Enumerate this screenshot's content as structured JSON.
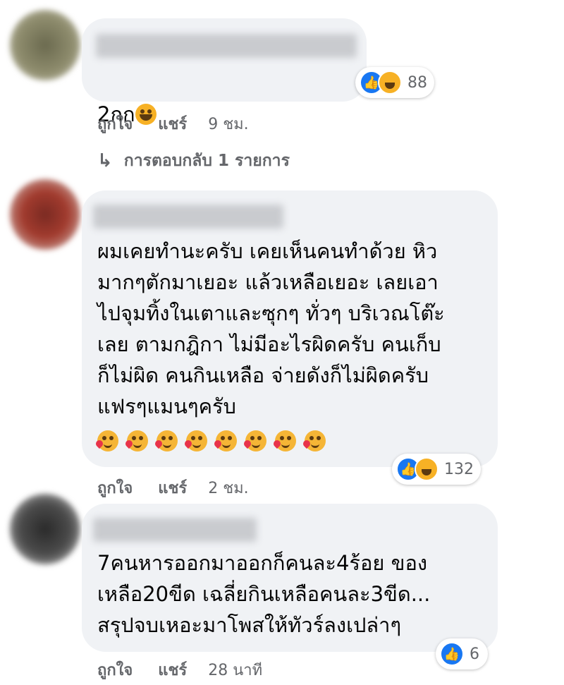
{
  "comments": [
    {
      "text": "2กก",
      "emoji": "grinning-sweat-emoji",
      "reaction_count": "88",
      "actions": {
        "like": "ถูกใจ",
        "share": "แชร์",
        "time": "9 ชม."
      },
      "replies_label": "การตอบกลับ 1 รายการ"
    },
    {
      "text": "ผมเคยทำนะครับ เคยเห็นคนทำด้วย หิว\nมากๆตักมาเยอะ แล้วเหลือเยอะ เลยเอา\nไปจุมทิ้งในเตาและซุกๆ ทั่วๆ บริเวณโต๊ะ\nเลย ตามกฎิกา ไม่มีอะไรผิดครับ คนเก็บ\nก็ไม่ผิด คนกินเหลือ จ่ายดังก็ไม่ผิดครับ\nแฟรๆแมนๆครับ",
      "emoji": "smiling-hearts-emoji",
      "emoji_count": 8,
      "reaction_count": "132",
      "actions": {
        "like": "ถูกใจ",
        "share": "แชร์",
        "time": "2 ชม."
      }
    },
    {
      "text": "7คนหารออกมาออกก็คนละ4ร้อย ของ\nเหลือ20ขีด เฉลี่ยกินเหลือคนละ3ขีด...\nสรุปจบเหอะมาโพสให้ทัวร์ลงเปล่าๆ",
      "reaction_count": "6",
      "actions": {
        "like": "ถูกใจ",
        "share": "แชร์",
        "time": "28 นาที"
      }
    }
  ],
  "colors": {
    "bubble": "#f0f2f5",
    "secondary_text": "#65676b",
    "like_blue": "#1877f2",
    "haha_yellow": "#f7b125"
  }
}
